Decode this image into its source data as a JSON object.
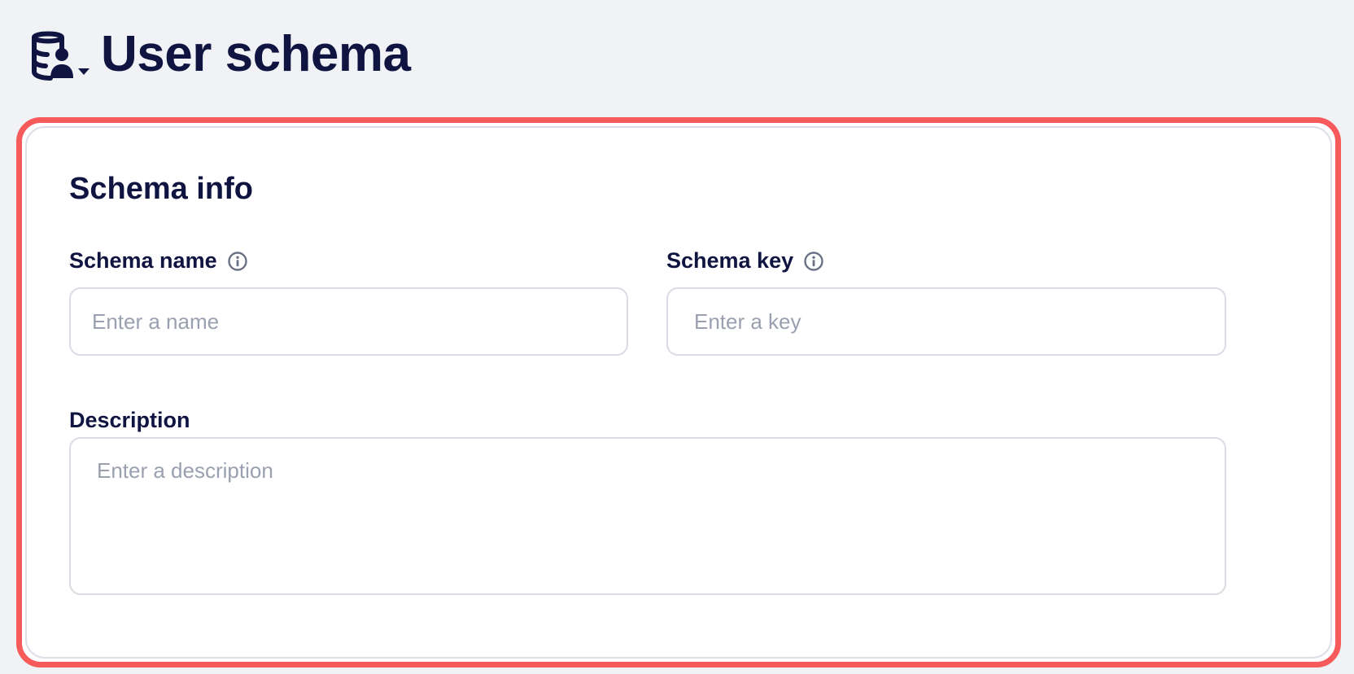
{
  "header": {
    "title": "User schema",
    "icon": "user-database-icon"
  },
  "card": {
    "highlight_color": "#f75a5a",
    "section_title": "Schema info",
    "fields": {
      "schema_name": {
        "label": "Schema name",
        "placeholder": "Enter a name",
        "value": "",
        "icon": "info-icon"
      },
      "schema_key": {
        "label": "Schema key",
        "placeholder": "Enter a key",
        "value": "",
        "icon": "info-icon"
      },
      "description": {
        "label": "Description",
        "placeholder": "Enter a description",
        "value": ""
      }
    }
  },
  "colors": {
    "text_primary": "#0f1440",
    "background": "#f0f2f6",
    "placeholder": "#9aa0b0",
    "border": "#d9dce4"
  }
}
